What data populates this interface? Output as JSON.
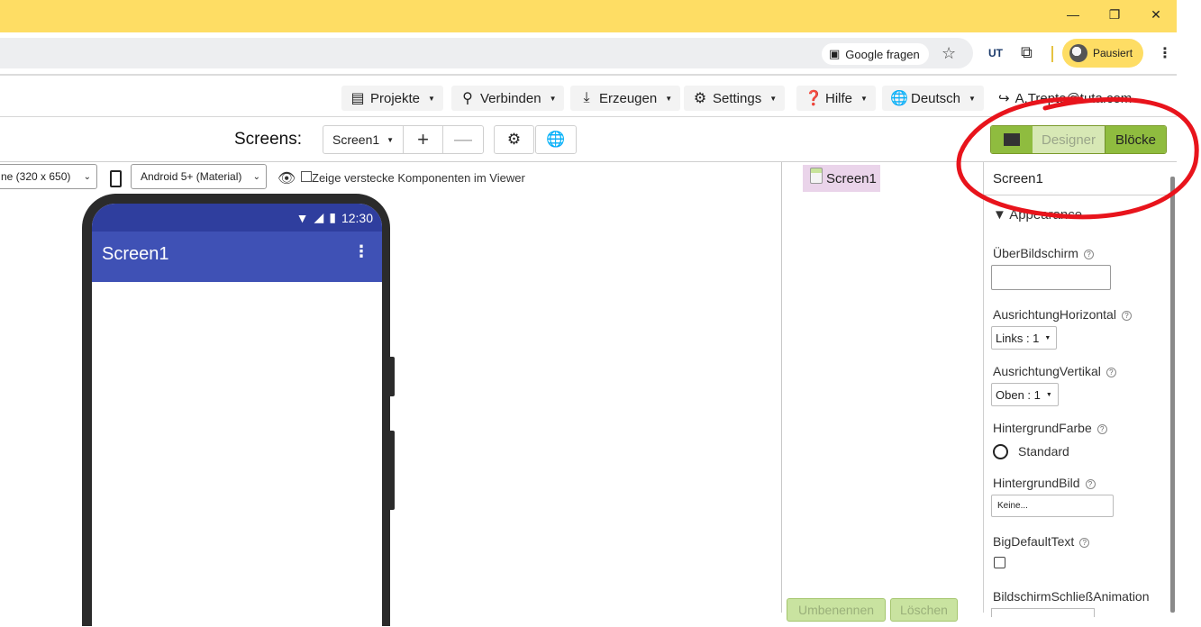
{
  "browser": {
    "omnibox_chip": "Google fragen",
    "extension_badge": "UT",
    "profile_label": "Pausiert"
  },
  "menu": {
    "projects": "Projekte",
    "connect": "Verbinden",
    "build": "Erzeugen",
    "settings": "Settings",
    "help": "Hilfe",
    "language": "Deutsch",
    "user": "A.Trepte@tuta.com"
  },
  "screens_bar": {
    "label": "Screens:",
    "current_screen": "Screen1",
    "designer": "Designer",
    "blocks": "Blöcke"
  },
  "viewer": {
    "device_size": "ne (320 x 650)",
    "theme": "Android 5+ (Material)",
    "hidden_components_label": "Zeige verstecke Komponenten im Viewer",
    "status_time": "12:30",
    "app_title": "Screen1"
  },
  "components": {
    "root": "Screen1",
    "rename": "Umbenennen",
    "delete": "Löschen"
  },
  "properties": {
    "title": "Screen1",
    "section": "Appearance",
    "about_label": "ÜberBildschirm",
    "align_h_label": "AusrichtungHorizontal",
    "align_h_value": "Links : 1",
    "align_v_label": "AusrichtungVertikal",
    "align_v_value": "Oben : 1",
    "bg_color_label": "HintergrundFarbe",
    "bg_color_value": "Standard",
    "bg_image_label": "HintergrundBild",
    "bg_image_value": "Keine...",
    "big_text_label": "BigDefaultText",
    "close_anim_label": "BildschirmSchließAnimation"
  },
  "colors": {
    "chrome_accent": "#fedd64",
    "appbar": "#3f51b5",
    "statusbar": "#2f3e9e",
    "toggle_green": "#8fbc3f",
    "annotation_red": "#e8141c"
  }
}
